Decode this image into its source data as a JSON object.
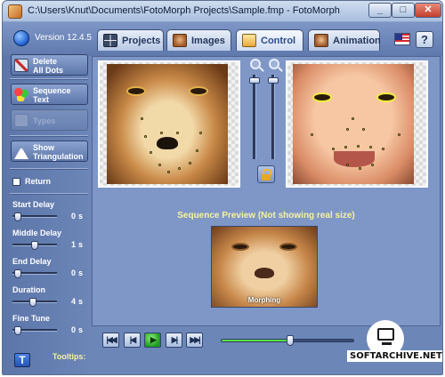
{
  "window": {
    "title": "C:\\Users\\Knut\\Documents\\FotoMorph Projects\\Sample.fmp - FotoMorph",
    "minimize_glyph": "_",
    "maximize_glyph": "□",
    "close_glyph": "✕"
  },
  "topbar": {
    "version": "Version 12.4.5",
    "tabs": [
      {
        "label": "Projects",
        "icon": "grid-icon"
      },
      {
        "label": "Images",
        "icon": "face-icon"
      },
      {
        "label": "Control",
        "icon": "control-icon",
        "active": true
      },
      {
        "label": "Animation",
        "icon": "face-icon"
      }
    ],
    "help_glyph": "?"
  },
  "sidebar": {
    "buttons": [
      {
        "label": "Delete\nAll Dots"
      },
      {
        "label": "Sequence\nText"
      },
      {
        "label": "Types",
        "disabled": true
      },
      {
        "label": "Show\nTriangulation"
      }
    ],
    "return_label": "Return",
    "sliders": [
      {
        "label": "Start Delay",
        "value": "0",
        "unit": "s",
        "level": 0.05
      },
      {
        "label": "Middle Delay",
        "value": "1",
        "unit": "s",
        "level": 0.5
      },
      {
        "label": "End Delay",
        "value": "0",
        "unit": "s",
        "level": 0.05
      },
      {
        "label": "Duration",
        "value": "4",
        "unit": "s",
        "level": 0.45
      },
      {
        "label": "Fine Tune",
        "value": "0",
        "unit": "s",
        "level": 0.05
      }
    ],
    "tooltip_icon_glyph": "T"
  },
  "main": {
    "preview_title": "Sequence Preview (Not showing real size)",
    "preview_caption": "Morphing"
  },
  "playback": {
    "buttons": [
      "|◀◀",
      "|◀",
      "▶",
      "▶|",
      "▶▶|"
    ],
    "timeline_level": 0.52,
    "tooltips_label": "Tooltips:"
  },
  "watermark": {
    "text": "SOFTARCHIVE.NET"
  },
  "colors": {
    "panel": "#6c86b8",
    "main": "#7f97c7",
    "accent_text": "#f7f2a0",
    "dots": "#f3ef3a"
  }
}
